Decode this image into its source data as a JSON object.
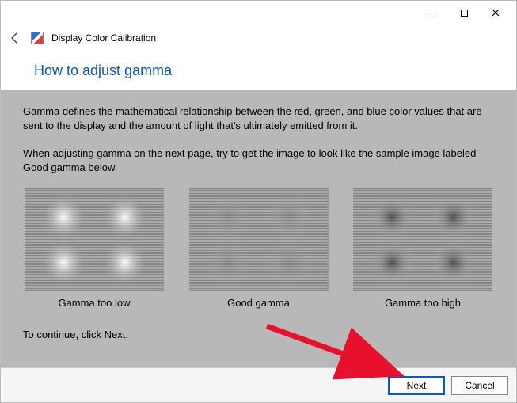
{
  "window": {
    "app_title": "Display Color Calibration"
  },
  "page": {
    "headline": "How to adjust gamma",
    "paragraph1": "Gamma defines the mathematical relationship between the red, green, and blue color values that are sent to the display and the amount of light that's ultimately emitted from it.",
    "paragraph2": "When adjusting gamma on the next page, try to get the image to look like the sample image labeled Good gamma below.",
    "continue_hint": "To continue, click Next."
  },
  "samples": {
    "low": {
      "label": "Gamma too low"
    },
    "good": {
      "label": "Good gamma"
    },
    "high": {
      "label": "Gamma too high"
    }
  },
  "buttons": {
    "next": "Next",
    "cancel": "Cancel"
  }
}
